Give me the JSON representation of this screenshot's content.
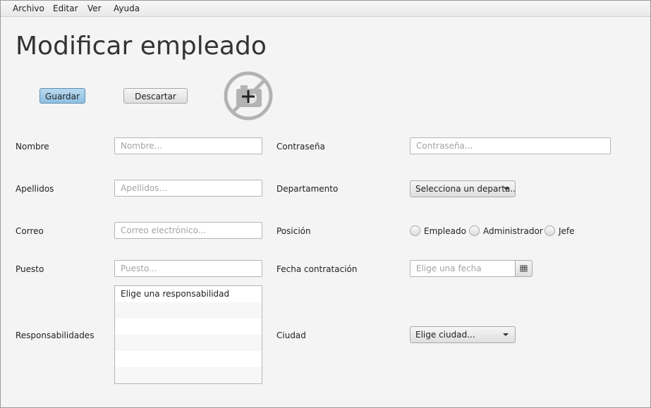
{
  "menu": [
    "Archivo",
    "Editar",
    "Ver",
    "Ayuda"
  ],
  "page": {
    "title": "Modificar empleado"
  },
  "actions": {
    "save": "Guardar",
    "discard": "Descartar"
  },
  "photo": {
    "icon": "no-photo-add-icon"
  },
  "form": {
    "nombre": {
      "label": "Nombre",
      "placeholder": "Nombre..."
    },
    "apellidos": {
      "label": "Apellidos",
      "placeholder": "Apellidos..."
    },
    "correo": {
      "label": "Correo",
      "placeholder": "Correo electrónico..."
    },
    "puesto": {
      "label": "Puesto",
      "placeholder": "Puesto..."
    },
    "responsabilidades": {
      "label": "Responsabilidades",
      "items": [
        "Elige una responsabilidad",
        "",
        "",
        "",
        "",
        ""
      ]
    },
    "contrasena": {
      "label": "Contraseña",
      "placeholder": "Contraseña..."
    },
    "departamento": {
      "label": "Departamento",
      "value": "Selecciona un departa..."
    },
    "posicion": {
      "label": "Posición",
      "options": [
        "Empleado",
        "Administrador",
        "Jefe"
      ]
    },
    "fecha": {
      "label": "Fecha contratación",
      "placeholder": "Elige una fecha",
      "icon": "calendar-icon"
    },
    "ciudad": {
      "label": "Ciudad",
      "value": "Elige ciudad..."
    }
  }
}
